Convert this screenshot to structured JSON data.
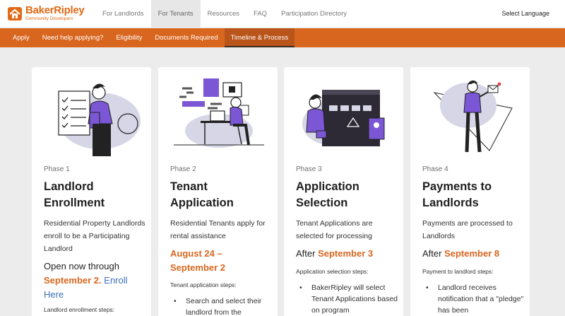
{
  "brand": {
    "name": "BakerRipley",
    "subtitle": "Community Developers"
  },
  "top_nav": [
    {
      "label": "For Landlords",
      "active": false
    },
    {
      "label": "For Tenants",
      "active": true
    },
    {
      "label": "Resources",
      "active": false
    },
    {
      "label": "FAQ",
      "active": false
    },
    {
      "label": "Participation Directory",
      "active": false
    }
  ],
  "language_selector": "Select Language",
  "sub_nav": [
    {
      "label": "Apply",
      "active": false
    },
    {
      "label": "Need help applying?",
      "active": false
    },
    {
      "label": "Eligibility",
      "active": false
    },
    {
      "label": "Documents Required",
      "active": false
    },
    {
      "label": "Timeline & Process",
      "active": true
    }
  ],
  "colors": {
    "accent": "#d9661f",
    "illustration_purple": "#7b57d6",
    "illustration_gray": "#d6d6e6",
    "link": "#3d6fb6"
  },
  "cards": [
    {
      "phase": "Phase 1",
      "title_line1": "Landlord",
      "title_line2": "Enrollment",
      "description": "Residential Property Landlords enroll to be a Participating Landlord",
      "status_prefix": "Open now through",
      "status_date": "September 2.",
      "status_link": "Enroll Here",
      "steps_label": "Landlord enrollment steps:",
      "illustration": "checklist-person-icon"
    },
    {
      "phase": "Phase 2",
      "title_line1": "Tenant",
      "title_line2": "Application",
      "description": "Residential Tenants apply for rental assistance",
      "date_range_line1": "August 24 –",
      "date_range_line2": "September 2",
      "steps_label": "Tenant application steps:",
      "bullet_1": "Search and select their landlord from the",
      "illustration": "person-at-desk-icon"
    },
    {
      "phase": "Phase 3",
      "title_line1": "Application",
      "title_line2": "Selection",
      "description": "Tenant Applications are selected for processing",
      "after_prefix": "After",
      "after_date": "September 3",
      "steps_label": "Application selection steps:",
      "bullet_1": "BakerRipley will select Tenant Applications based on program",
      "illustration": "presentation-board-icon"
    },
    {
      "phase": "Phase 4",
      "title_line1": "Payments to",
      "title_line2": "Landlords",
      "description": "Payments are processed to Landlords",
      "after_prefix": "After",
      "after_date": "September 8",
      "steps_label": "Payment to landlord steps:",
      "bullet_1": "Landlord receives notification that a \"pledge\" has been",
      "illustration": "person-with-envelope-icon"
    }
  ]
}
